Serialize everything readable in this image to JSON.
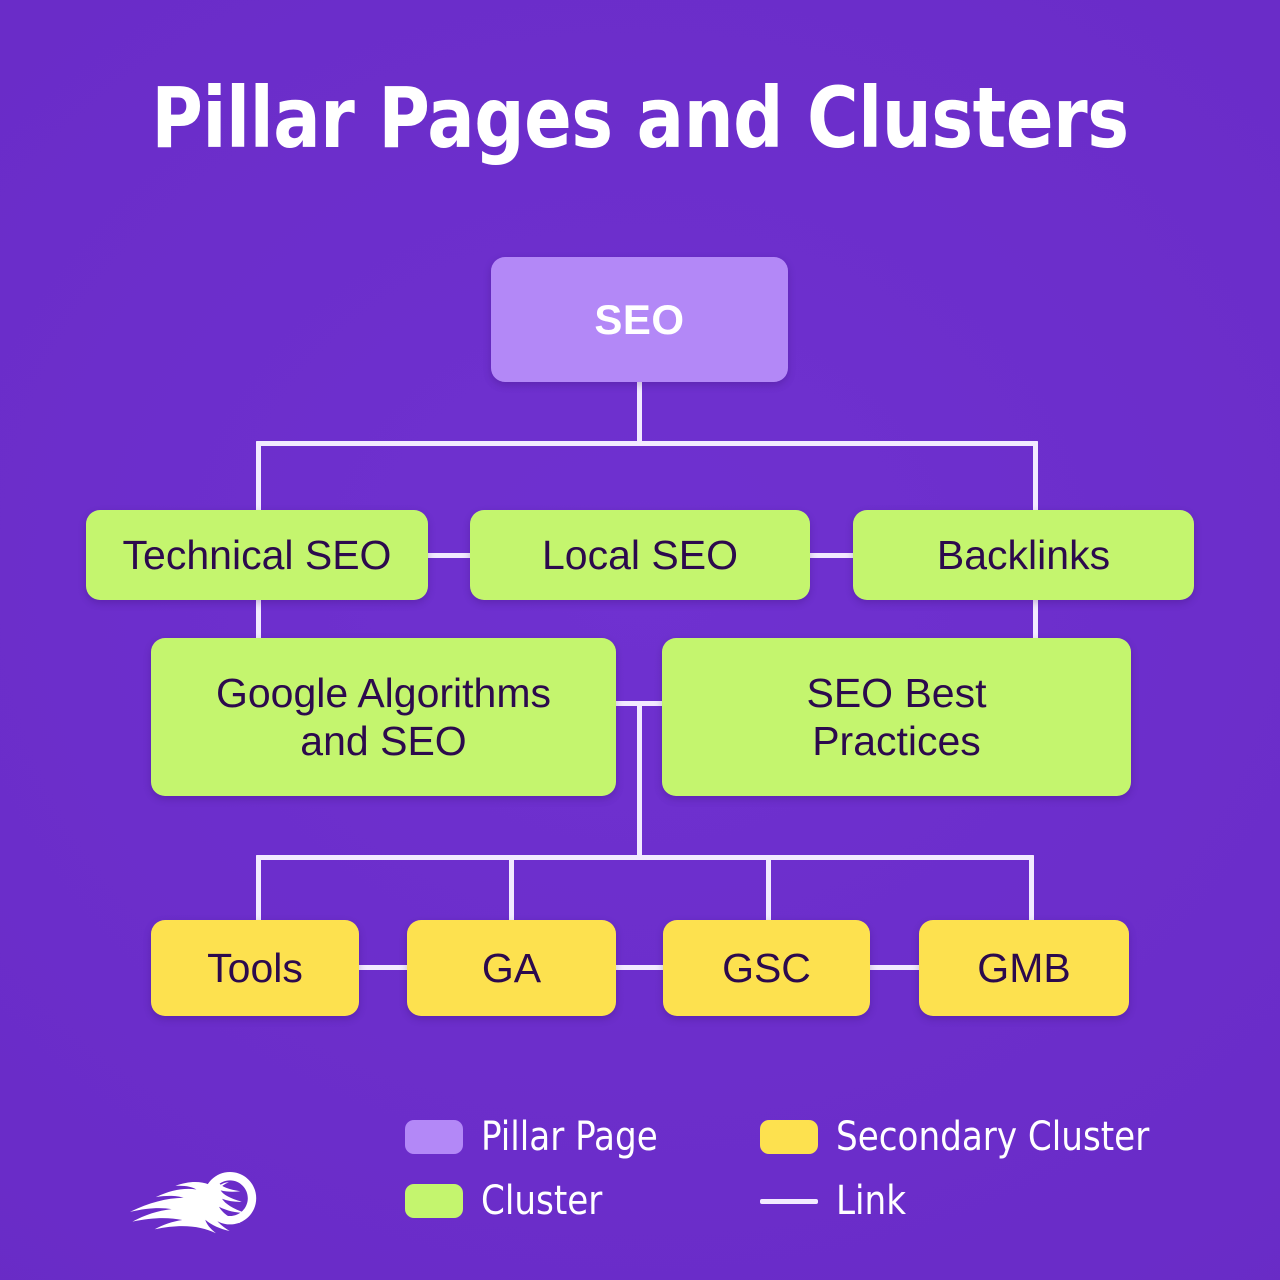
{
  "page": {
    "title": "Pillar Pages and Clusters",
    "background_color": "#6a2cc8"
  },
  "colors": {
    "background": "#6a2cc8",
    "pillar": "#b388f7",
    "cluster": "#c4f56e",
    "secondary_cluster": "#fde14f",
    "link": "#f2eaff",
    "node_text_dark": "#2c0a4d",
    "node_text_light": "#ffffff"
  },
  "diagram": {
    "type": "hierarchy",
    "nodes": [
      {
        "id": "seo",
        "label": "SEO",
        "kind": "pillar",
        "level": 0
      },
      {
        "id": "technical",
        "label": "Technical SEO",
        "kind": "cluster",
        "level": 1
      },
      {
        "id": "local",
        "label": "Local SEO",
        "kind": "cluster",
        "level": 1
      },
      {
        "id": "backlinks",
        "label": "Backlinks",
        "kind": "cluster",
        "level": 1
      },
      {
        "id": "algorithms",
        "label": "Google Algorithms and SEO",
        "kind": "cluster",
        "level": 2
      },
      {
        "id": "bestpract",
        "label": "SEO Best Practices",
        "kind": "cluster",
        "level": 2
      },
      {
        "id": "tools",
        "label": "Tools",
        "kind": "secondary",
        "level": 3
      },
      {
        "id": "ga",
        "label": "GA",
        "kind": "secondary",
        "level": 3
      },
      {
        "id": "gsc",
        "label": "GSC",
        "kind": "secondary",
        "level": 3
      },
      {
        "id": "gmb",
        "label": "GMB",
        "kind": "secondary",
        "level": 3
      }
    ],
    "edges": [
      {
        "from": "seo",
        "to": "technical"
      },
      {
        "from": "seo",
        "to": "backlinks"
      },
      {
        "from": "technical",
        "to": "local"
      },
      {
        "from": "local",
        "to": "backlinks"
      },
      {
        "from": "technical",
        "to": "algorithms"
      },
      {
        "from": "backlinks",
        "to": "bestpract"
      },
      {
        "from": "algorithms",
        "to": "bestpract"
      },
      {
        "from": "algorithms",
        "to": "tools"
      },
      {
        "from": "algorithms",
        "to": "ga"
      },
      {
        "from": "algorithms",
        "to": "gsc"
      },
      {
        "from": "algorithms",
        "to": "gmb"
      },
      {
        "from": "tools",
        "to": "ga"
      },
      {
        "from": "ga",
        "to": "gsc"
      },
      {
        "from": "gsc",
        "to": "gmb"
      }
    ],
    "node_labels": {
      "seo": "SEO",
      "technical": "Technical SEO",
      "local": "Local SEO",
      "backlinks": "Backlinks",
      "algorithms_line1": "Google Algorithms",
      "algorithms_line2": "and SEO",
      "bestpract_line1": "SEO Best",
      "bestpract_line2": "Practices",
      "tools": "Tools",
      "ga": "GA",
      "gsc": "GSC",
      "gmb": "GMB"
    }
  },
  "legend": {
    "items": [
      {
        "label": "Pillar Page",
        "swatch": "pillar",
        "color": "#b388f7"
      },
      {
        "label": "Secondary Cluster",
        "swatch": "secondary",
        "color": "#fde14f"
      },
      {
        "label": "Cluster",
        "swatch": "cluster",
        "color": "#c4f56e"
      },
      {
        "label": "Link",
        "swatch": "line",
        "color": "#f2eaff"
      }
    ]
  },
  "brand": {
    "logo_name": "semrush-flame-logo"
  }
}
